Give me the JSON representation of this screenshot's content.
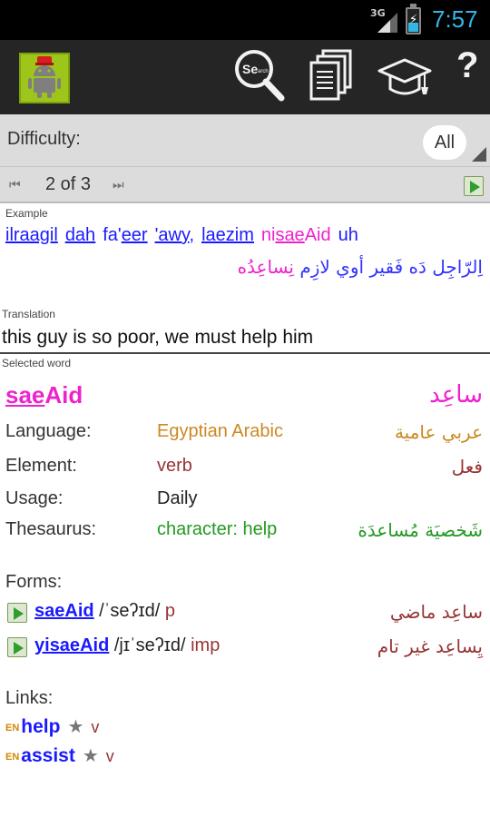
{
  "status_bar": {
    "network": "3G",
    "time": "7:57"
  },
  "action_bar": {
    "icons": [
      "app-icon",
      "search-icon",
      "documents-icon",
      "graduation-cap-icon",
      "help-icon"
    ],
    "search_icon_text": "Search",
    "help_glyph": "?"
  },
  "filter": {
    "difficulty_label": "Difficulty:",
    "difficulty_value": "All"
  },
  "pager": {
    "position": "2 of 3",
    "prev_glyph": "⏮",
    "next_glyph": "⏭"
  },
  "example": {
    "label": "Example",
    "words": [
      {
        "pre": "",
        "under": "ilraagil",
        "post": "",
        "style": "plain"
      },
      {
        "pre": "",
        "under": "dah",
        "post": "",
        "style": "link"
      },
      {
        "pre": "fa'",
        "under": "eer",
        "post": "",
        "style": "plain"
      },
      {
        "pre": "",
        "under": "'awy,",
        "post": "",
        "style": "link"
      },
      {
        "pre": "",
        "under": "laezim",
        "post": "",
        "style": "link"
      },
      {
        "pre": "ni",
        "under": "sae",
        "post": "Aid",
        "style": "focus"
      },
      {
        "pre": "",
        "under": "",
        "post": "uh",
        "style": "plain"
      }
    ],
    "arabic_before": "اِلرّاجِل دَه فَقير أوي لازِم",
    "arabic_focus": "نِساعِد",
    "arabic_after": "ُه"
  },
  "translation": {
    "label": "Translation",
    "text": "this guy is so poor, we must help him"
  },
  "selected_word": {
    "label": "Selected word",
    "word_underlined": "sae",
    "word_rest": "Aid",
    "arabic": "ساعِد",
    "details": [
      {
        "label": "Language:",
        "value": "Egyptian Arabic",
        "arabic": "عربي عامية",
        "color": "#cc8822"
      },
      {
        "label": "Element:",
        "value": "verb",
        "arabic": "فعل",
        "color": "#993333"
      },
      {
        "label": "Usage:",
        "value": "Daily",
        "arabic": "",
        "color": "#222222"
      },
      {
        "label": "Thesaurus:",
        "value": "character: help",
        "arabic": "شَخصيَة مُساعدَة",
        "color": "#229922"
      }
    ]
  },
  "forms": {
    "label": "Forms:",
    "items": [
      {
        "pre": "",
        "under": "sae",
        "post": "Aid",
        "ipa": "/ˈseʔɪd/",
        "tag": "p",
        "arabic": "ساعِد ماضي"
      },
      {
        "pre": "yi",
        "under": "sae",
        "post": "Aid",
        "ipa": "/jɪˈseʔɪd/",
        "tag": "imp",
        "arabic": "يِساعِد غير تام"
      }
    ]
  },
  "links": {
    "label": "Links:",
    "items": [
      {
        "lang": "EN",
        "word": "help",
        "star": "★",
        "pos": "v"
      },
      {
        "lang": "EN",
        "word": "assist",
        "star": "★",
        "pos": "v"
      }
    ]
  }
}
